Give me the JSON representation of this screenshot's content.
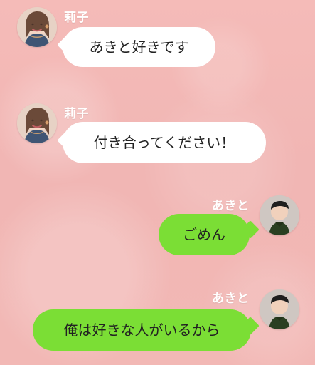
{
  "messages": [
    {
      "sender": "莉子",
      "text": "あきと好きです",
      "direction": "incoming"
    },
    {
      "sender": "莉子",
      "text": "付き合ってください！",
      "direction": "incoming"
    },
    {
      "sender": "あきと",
      "text": "ごめん",
      "direction": "outgoing"
    },
    {
      "sender": "あきと",
      "text": "俺は好きな人がいるから",
      "direction": "outgoing"
    }
  ],
  "colors": {
    "background": "#f2b9b6",
    "incoming_bubble": "#ffffff",
    "outgoing_bubble": "#7bde35",
    "name_text": "#ffffff"
  },
  "icons": {
    "incoming_avatar": "woman-avatar-icon",
    "outgoing_avatar": "man-avatar-icon"
  }
}
